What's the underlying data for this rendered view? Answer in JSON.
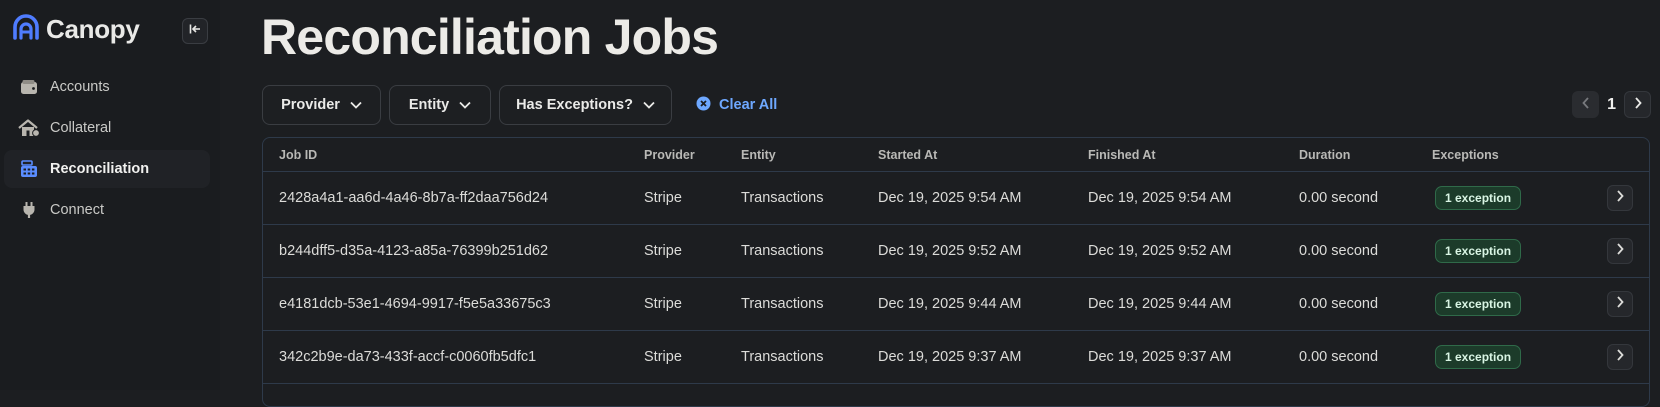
{
  "app": {
    "name": "Canopy"
  },
  "sidebar": {
    "items": [
      {
        "label": "Accounts",
        "icon": "wallet-icon",
        "active": false
      },
      {
        "label": "Collateral",
        "icon": "house-icon",
        "active": false
      },
      {
        "label": "Reconciliation",
        "icon": "calculator-icon",
        "active": true
      },
      {
        "label": "Connect",
        "icon": "plug-icon",
        "active": false
      }
    ]
  },
  "page": {
    "title": "Reconciliation Jobs"
  },
  "filters": {
    "provider": "Provider",
    "entity": "Entity",
    "has_exceptions": "Has Exceptions?",
    "clear_all": "Clear All"
  },
  "pager": {
    "current": "1"
  },
  "table": {
    "headers": {
      "job_id": "Job ID",
      "provider": "Provider",
      "entity": "Entity",
      "started_at": "Started At",
      "finished_at": "Finished At",
      "duration": "Duration",
      "exceptions": "Exceptions"
    },
    "rows": [
      {
        "job_id": "2428a4a1-aa6d-4a46-8b7a-ff2daa756d24",
        "provider": "Stripe",
        "entity": "Transactions",
        "started_at": "Dec 19, 2025 9:54 AM",
        "finished_at": "Dec 19, 2025 9:54 AM",
        "duration": "0.00 second",
        "exceptions": "1 exception"
      },
      {
        "job_id": "b244dff5-d35a-4123-a85a-76399b251d62",
        "provider": "Stripe",
        "entity": "Transactions",
        "started_at": "Dec 19, 2025 9:52 AM",
        "finished_at": "Dec 19, 2025 9:52 AM",
        "duration": "0.00 second",
        "exceptions": "1 exception"
      },
      {
        "job_id": "e4181dcb-53e1-4694-9917-f5e5a33675c3",
        "provider": "Stripe",
        "entity": "Transactions",
        "started_at": "Dec 19, 2025 9:44 AM",
        "finished_at": "Dec 19, 2025 9:44 AM",
        "duration": "0.00 second",
        "exceptions": "1 exception"
      },
      {
        "job_id": "342c2b9e-da73-433f-accf-c0060fb5dfc1",
        "provider": "Stripe",
        "entity": "Transactions",
        "started_at": "Dec 19, 2025 9:37 AM",
        "finished_at": "Dec 19, 2025 9:37 AM",
        "duration": "0.00 second",
        "exceptions": "1 exception"
      }
    ]
  },
  "colors": {
    "background": "#1c1e21",
    "accent": "#6ea8ff",
    "brand": "#4f7cff",
    "badge_bg": "#1c3b2a",
    "border": "#2e3a4a"
  }
}
